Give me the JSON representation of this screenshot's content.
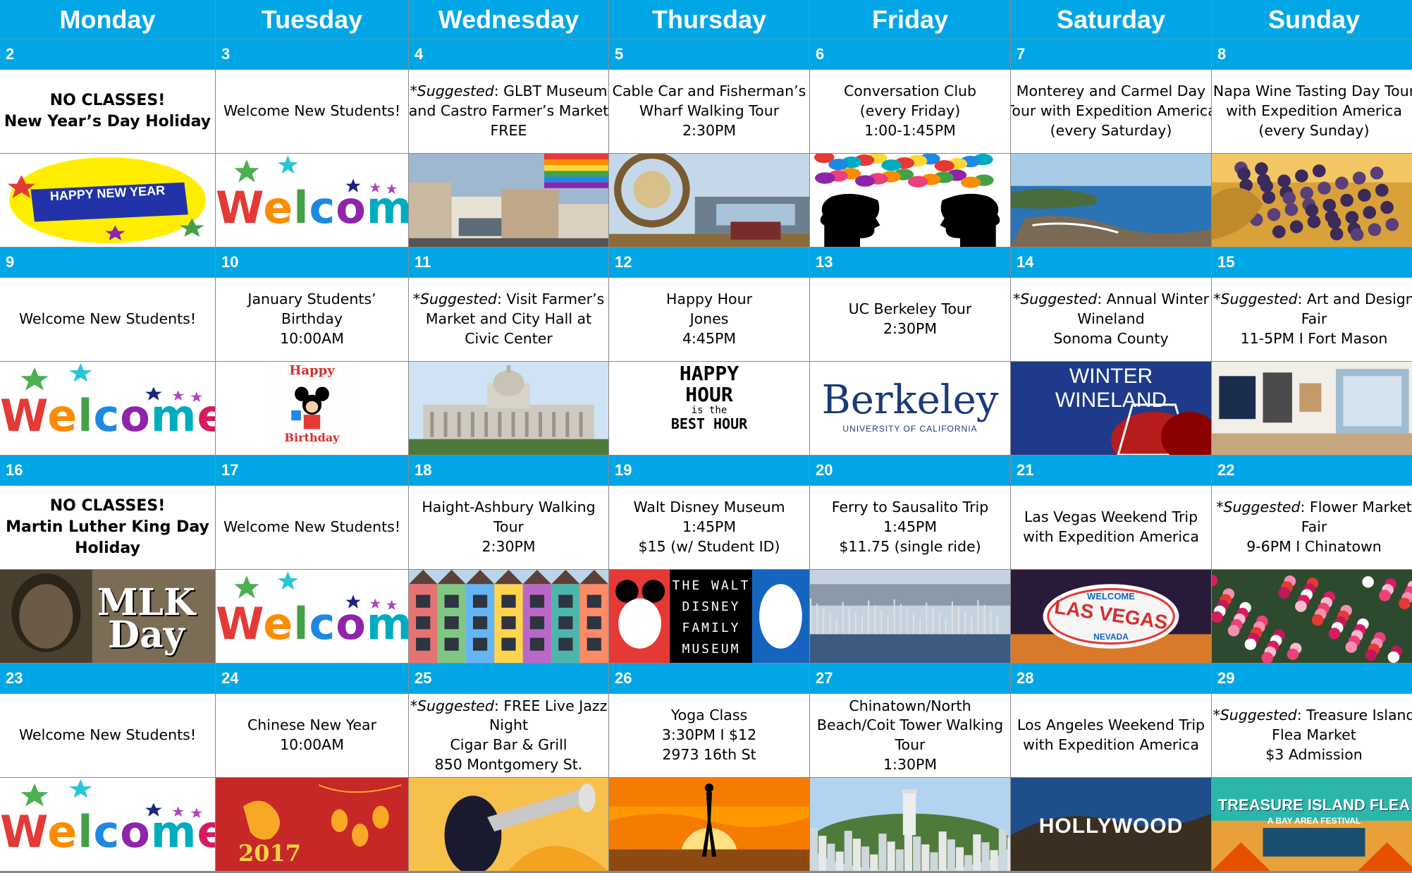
{
  "days": [
    "Monday",
    "Tuesday",
    "Wednesday",
    "Thursday",
    "Friday",
    "Saturday",
    "Sunday"
  ],
  "weeks": [
    {
      "dates": [
        "2",
        "3",
        "4",
        "5",
        "6",
        "7",
        "8"
      ],
      "events": [
        {
          "bold": true,
          "lines": [
            "NO CLASSES!",
            "New Year’s Day Holiday"
          ]
        },
        {
          "lines": [
            "Welcome New Students!"
          ]
        },
        {
          "suggested": true,
          "lines": [
            "*Suggested: GLBT Museum",
            "and Castro Farmer’s Market",
            "FREE"
          ]
        },
        {
          "lines": [
            "Cable Car and Fisherman’s",
            "Wharf Walking Tour",
            "2:30PM"
          ]
        },
        {
          "lines": [
            "Conversation Club",
            "(every Friday)",
            "1:00-1:45PM"
          ]
        },
        {
          "lines": [
            "Monterey and Carmel Day",
            "Tour with Expedition America",
            "(every Saturday)"
          ]
        },
        {
          "lines": [
            "Napa Wine Tasting Day Tour",
            "with Expedition America",
            "(every Sunday)"
          ]
        }
      ],
      "images": [
        {
          "icon": "happy-new-year-banner",
          "text": "HAPPY NEW YEAR"
        },
        {
          "icon": "welcome-graphic",
          "text": "Welcome"
        },
        {
          "icon": "castro-rainbow-flag-photo"
        },
        {
          "icon": "fishermans-wharf-sign-photo"
        },
        {
          "icon": "conversation-silhouettes-graphic"
        },
        {
          "icon": "monterey-coast-photo"
        },
        {
          "icon": "wine-grapes-photo"
        }
      ]
    },
    {
      "dates": [
        "9",
        "10",
        "11",
        "12",
        "13",
        "14",
        "15"
      ],
      "events": [
        {
          "lines": [
            "Welcome New Students!"
          ]
        },
        {
          "lines": [
            "January Students’",
            "Birthday",
            "10:00AM"
          ]
        },
        {
          "suggested": true,
          "lines": [
            "*Suggested: Visit Farmer’s",
            "Market and City Hall at",
            "Civic Center"
          ]
        },
        {
          "lines": [
            "Happy Hour",
            "Jones",
            "4:45PM"
          ]
        },
        {
          "lines": [
            "UC Berkeley Tour",
            "2:30PM"
          ]
        },
        {
          "suggested": true,
          "lines": [
            "*Suggested: Annual Winter",
            "Wineland",
            "Sonoma County"
          ]
        },
        {
          "suggested": true,
          "lines": [
            "*Suggested: Art and Design",
            "Fair",
            "11-5PM I Fort Mason"
          ]
        }
      ],
      "images": [
        {
          "icon": "welcome-graphic",
          "text": "Welcome"
        },
        {
          "icon": "mickey-happy-birthday-graphic",
          "text": "Happy",
          "text2": "Birthday"
        },
        {
          "icon": "city-hall-photo"
        },
        {
          "icon": "happy-hour-graphic",
          "text": "HAPPY",
          "text2": "HOUR",
          "text3": "is the",
          "text4": "BEST HOUR"
        },
        {
          "icon": "berkeley-logo",
          "text": "Berkeley",
          "text2": "UNIVERSITY OF CALIFORNIA"
        },
        {
          "icon": "winter-wineland-graphic",
          "text": "WINTER WINELAND"
        },
        {
          "icon": "art-gallery-photo"
        }
      ]
    },
    {
      "dates": [
        "16",
        "17",
        "18",
        "19",
        "20",
        "21",
        "22"
      ],
      "events": [
        {
          "bold": true,
          "lines": [
            "NO CLASSES!",
            "Martin Luther King Day",
            "Holiday"
          ]
        },
        {
          "lines": [
            "Welcome New Students!"
          ]
        },
        {
          "lines": [
            "Haight-Ashbury Walking",
            "Tour",
            "2:30PM"
          ]
        },
        {
          "lines": [
            "Walt Disney Museum",
            "1:45PM",
            "$15 (w/ Student ID)"
          ]
        },
        {
          "lines": [
            "Ferry to Sausalito Trip",
            "1:45PM",
            "$11.75 (single ride)"
          ]
        },
        {
          "lines": [
            "Las Vegas Weekend Trip",
            "with Expedition America"
          ]
        },
        {
          "suggested": true,
          "lines": [
            "*Suggested: Flower Market",
            "Fair",
            "9-6PM I Chinatown"
          ]
        }
      ],
      "images": [
        {
          "icon": "mlk-day-graphic",
          "text": "MLK",
          "text2": "Day"
        },
        {
          "icon": "welcome-graphic",
          "text": "Welcome"
        },
        {
          "icon": "painted-victorian-houses-photo"
        },
        {
          "icon": "walt-disney-family-museum-logo",
          "text": "THE WALT",
          "text2": "DISNEY",
          "text3": "FAMILY",
          "text4": "MUSEUM"
        },
        {
          "icon": "sausalito-marina-photo"
        },
        {
          "icon": "las-vegas-sign-photo",
          "text": "WELCOME",
          "text2": "LAS VEGAS",
          "text3": "NEVADA"
        },
        {
          "icon": "flower-market-photo"
        }
      ]
    },
    {
      "dates": [
        "23",
        "24",
        "25",
        "26",
        "27",
        "28",
        "29"
      ],
      "events": [
        {
          "lines": [
            "Welcome New Students!"
          ]
        },
        {
          "lines": [
            "Chinese New Year",
            "10:00AM"
          ]
        },
        {
          "suggested": true,
          "lines": [
            "*Suggested: FREE Live Jazz",
            "Night",
            "Cigar Bar & Grill",
            "850 Montgomery St."
          ]
        },
        {
          "lines": [
            "Yoga Class",
            "3:30PM I $12",
            "2973 16th St"
          ]
        },
        {
          "lines": [
            "Chinatown/North",
            "Beach/Coit Tower Walking",
            "Tour",
            "1:30PM"
          ]
        },
        {
          "lines": [
            "Los Angeles Weekend Trip",
            "with Expedition America"
          ]
        },
        {
          "suggested": true,
          "lines": [
            "*Suggested: Treasure Island",
            "Flea Market",
            "$3 Admission"
          ]
        }
      ],
      "images": [
        {
          "icon": "welcome-graphic",
          "text": "Welcome"
        },
        {
          "icon": "chinese-new-year-rooster-graphic",
          "text": "2017"
        },
        {
          "icon": "jazz-trumpet-graphic"
        },
        {
          "icon": "yoga-sunset-photo"
        },
        {
          "icon": "coit-tower-photo"
        },
        {
          "icon": "hollywood-sign-photo",
          "text": "HOLLYWOOD"
        },
        {
          "icon": "treasure-island-flea-graphic",
          "text": "TREASURE ISLAND FLEA",
          "text2": "A BAY AREA FESTIVAL"
        }
      ]
    }
  ],
  "colors": {
    "header_bg": "#00a6e6",
    "header_text": "#ffffff",
    "grid": "#8a8a8a"
  }
}
